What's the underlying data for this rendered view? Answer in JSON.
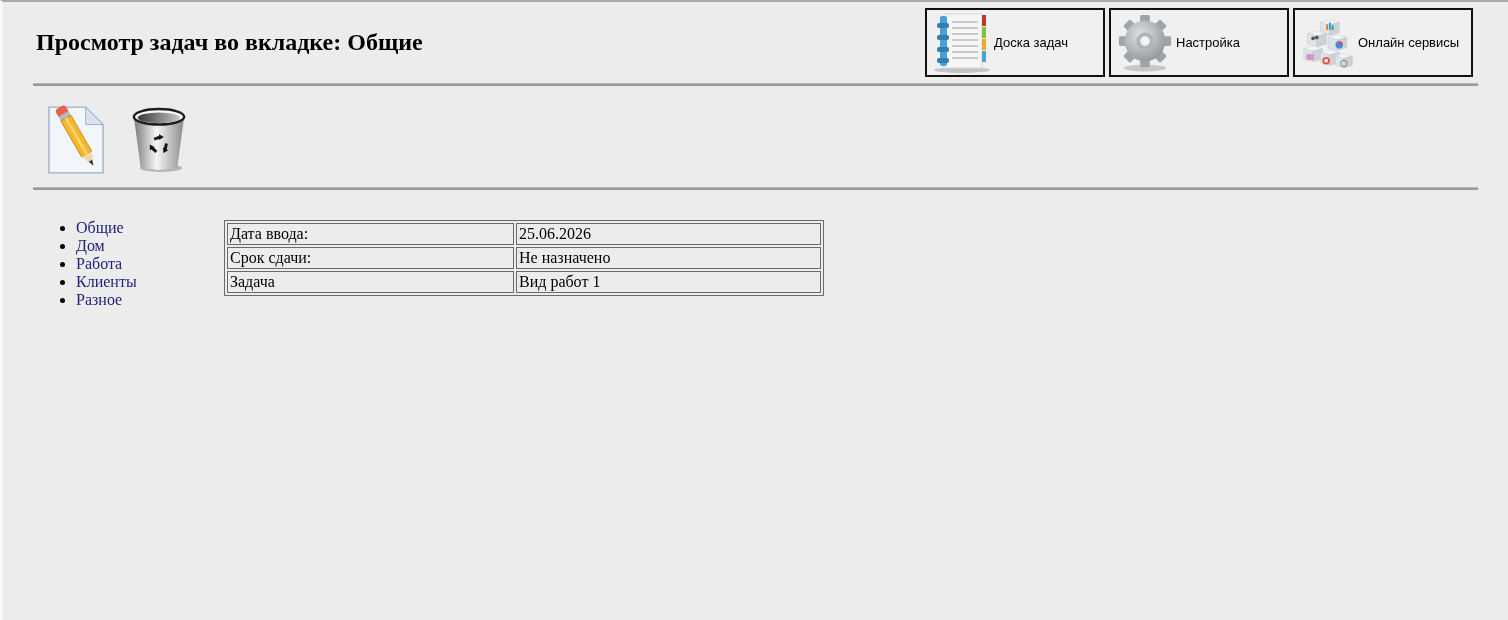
{
  "header": {
    "title": "Просмотр задач во вкладке: Общие",
    "buttons": [
      {
        "label": "Доска задач",
        "kind": "board"
      },
      {
        "label": "Настройка",
        "kind": "settings"
      },
      {
        "label": "Онлайн сервисы",
        "kind": "services"
      }
    ]
  },
  "toolbar": {
    "tools": [
      {
        "kind": "edit"
      },
      {
        "kind": "delete"
      }
    ]
  },
  "tabs": [
    {
      "label": "Общие"
    },
    {
      "label": "Дом"
    },
    {
      "label": "Работа"
    },
    {
      "label": "Клиенты"
    },
    {
      "label": "Разное"
    }
  ],
  "task_table": {
    "rows": [
      {
        "label": "Дата ввода:",
        "value": "25.06.2026"
      },
      {
        "label": "Срок сдачи:",
        "value": "Не назначено"
      },
      {
        "label": "Задача",
        "value": "Вид работ 1"
      }
    ]
  }
}
